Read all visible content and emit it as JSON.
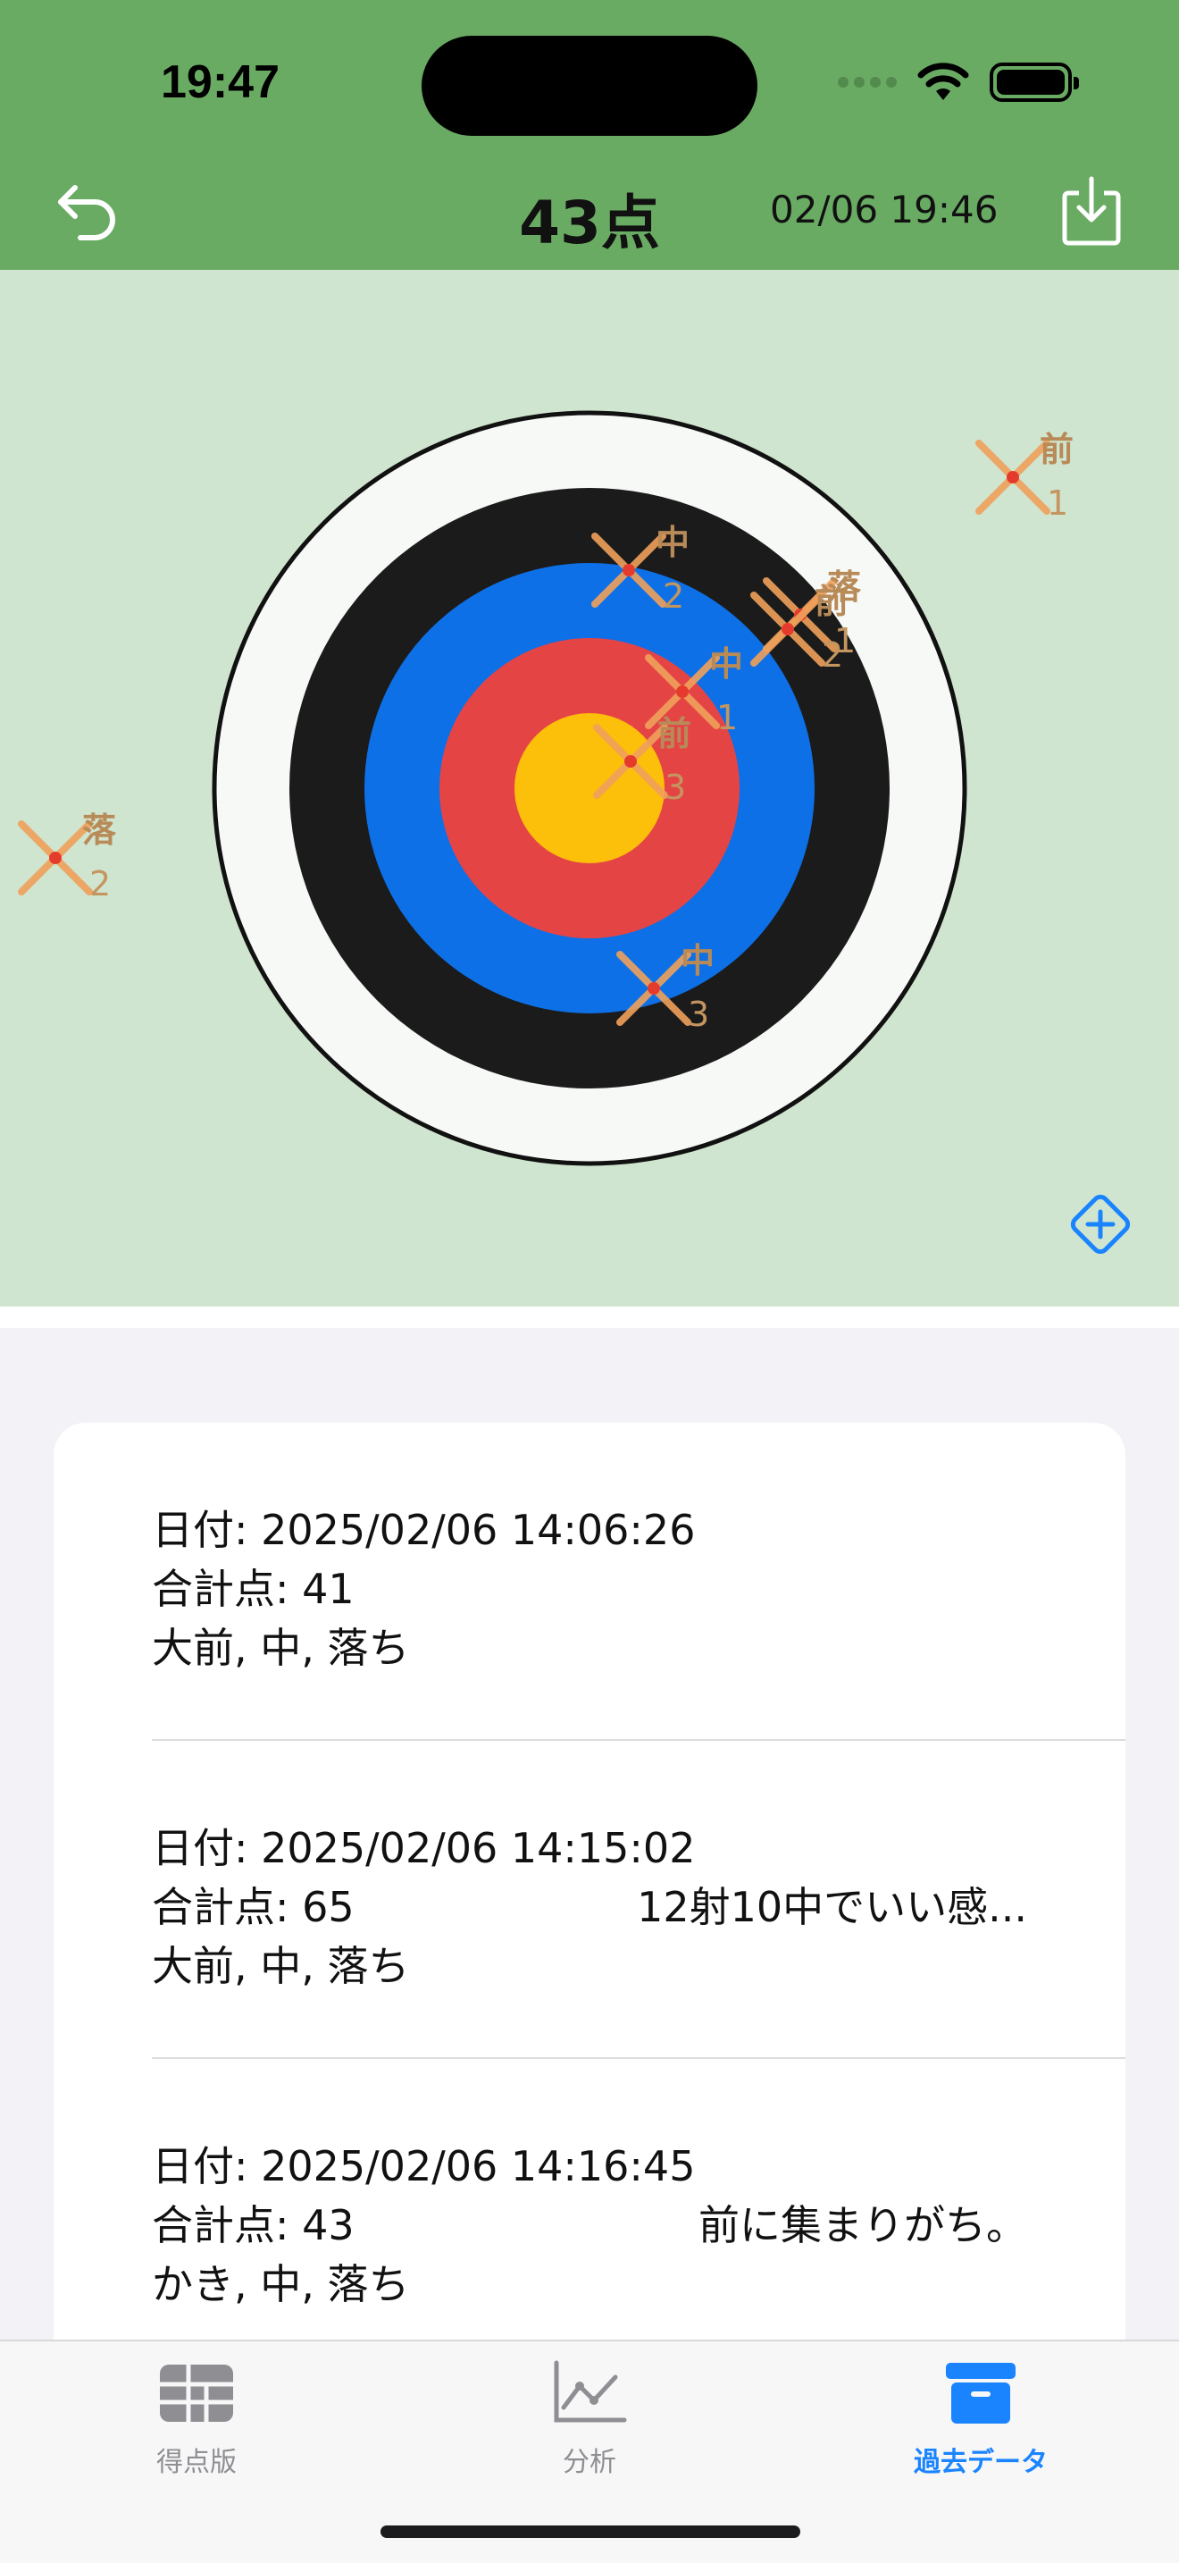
{
  "status_bar": {
    "time": "19:47"
  },
  "header": {
    "score": "43点",
    "datetime": "02/06 19:46"
  },
  "target": {
    "rings_colors": [
      "#f7f9f6",
      "#1b1b1b",
      "#0d70e6",
      "#e54445",
      "#fcbf0a"
    ],
    "cross_color": "#f0a15b",
    "shots": [
      {
        "label": "前",
        "number": "1"
      },
      {
        "label": "中",
        "number": "2"
      },
      {
        "label": "落",
        "number": "1"
      },
      {
        "label": "前",
        "number": "2"
      },
      {
        "label": "中",
        "number": "1"
      },
      {
        "label": "前",
        "number": "3"
      },
      {
        "label": "落",
        "number": "2"
      },
      {
        "label": "中",
        "number": "3"
      }
    ]
  },
  "records": [
    {
      "date": "日付: 2025/02/06 14:06:26",
      "total": "合計点: 41",
      "memo": "",
      "result": "大前, 中, 落ち"
    },
    {
      "date": "日付: 2025/02/06 14:15:02",
      "total": "合計点: 65",
      "memo": "12射10中でいい感...",
      "result": "大前, 中, 落ち"
    },
    {
      "date": "日付: 2025/02/06 14:16:45",
      "total": "合計点: 43",
      "memo": "前に集まりがち。",
      "result": "かき, 中, 落ち"
    }
  ],
  "tabs": [
    {
      "label": "得点版",
      "icon": "grid-icon",
      "active": false
    },
    {
      "label": "分析",
      "icon": "chart-icon",
      "active": false
    },
    {
      "label": "過去データ",
      "icon": "archive-box-icon",
      "active": true
    }
  ],
  "colors": {
    "header_green": "#6aab64",
    "panel_green": "#d0e5cf",
    "accent_blue": "#1a84ff"
  }
}
